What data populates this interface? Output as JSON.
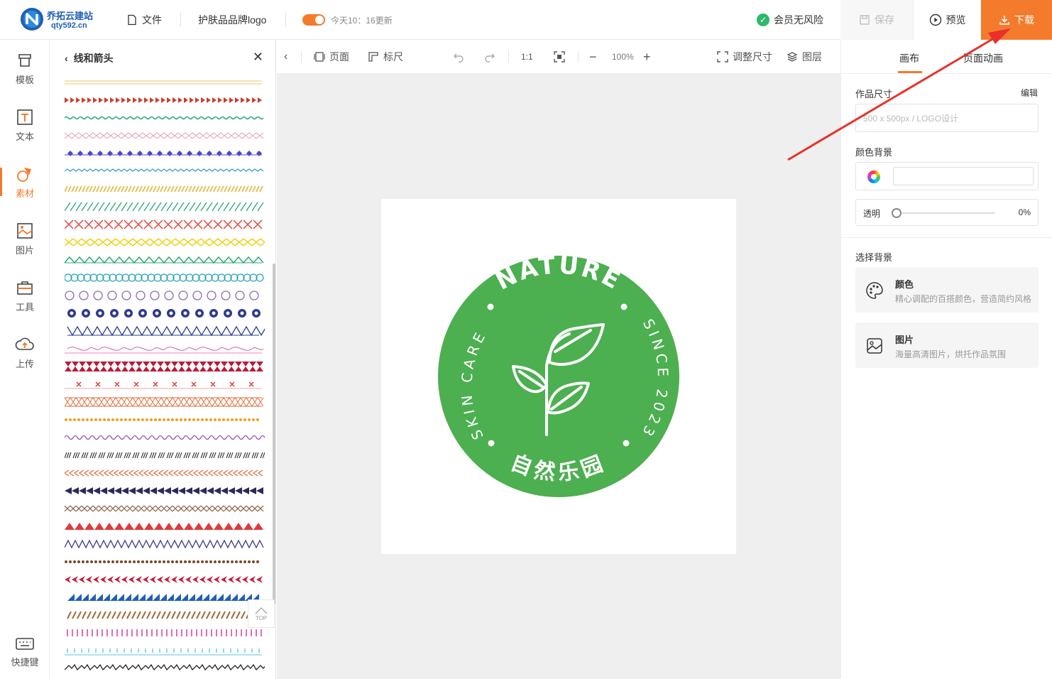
{
  "header": {
    "site_name": "乔拓云建站",
    "site_url": "qty592.cn",
    "file_menu": "文件",
    "document_title": "护肤品品牌logo",
    "update_text": "今天10：16更新",
    "member_text": "会员无风险",
    "save_label": "保存",
    "preview_label": "预览",
    "download_label": "下载",
    "accent_color": "#f47b2b"
  },
  "rail": {
    "items": [
      {
        "label": "模板",
        "icon": "template-icon"
      },
      {
        "label": "文本",
        "icon": "text-icon"
      },
      {
        "label": "素材",
        "icon": "material-icon",
        "active": true
      },
      {
        "label": "图片",
        "icon": "image-icon"
      },
      {
        "label": "工具",
        "icon": "toolbox-icon"
      },
      {
        "label": "上传",
        "icon": "upload-icon"
      }
    ],
    "shortcut_label": "快捷键"
  },
  "panel": {
    "title": "线和箭头",
    "top_button": "TOP"
  },
  "toolbar": {
    "page_label": "页面",
    "ruler_label": "标尺",
    "ratio_label": "1:1",
    "zoom_value": "100%",
    "resize_label": "调整尺寸",
    "layers_label": "图层"
  },
  "logo_art": {
    "top_text": "NATURE",
    "left_text": "SKIN CARE",
    "right_text": "SINCE 2023",
    "bottom_text": "自然乐园",
    "brand_green": "#4caf50"
  },
  "right_panel": {
    "tab_canvas": "画布",
    "tab_animation": "页面动画",
    "size_label": "作品尺寸",
    "edit_label": "编辑",
    "size_value": "500 x 500px   / LOGO设计",
    "bg_color_label": "颜色背景",
    "opacity_label": "透明",
    "opacity_value": "0%",
    "choose_bg_label": "选择背景",
    "cards": [
      {
        "title": "颜色",
        "desc": "精心调配的百搭颜色，营造简约风格",
        "icon": "palette-icon"
      },
      {
        "title": "图片",
        "desc": "海量高清图片，烘托作品氛围",
        "icon": "picture-icon"
      }
    ]
  }
}
